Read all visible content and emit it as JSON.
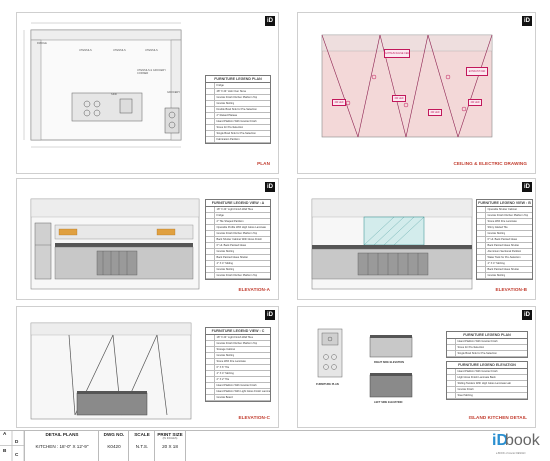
{
  "brand": {
    "logo_mark": "iD",
    "name": "book",
    "tagline": "a BOOK of interior DESIGN"
  },
  "sheets": {
    "plan": {
      "caption": "PLAN",
      "rooms": [
        "FRIDGE",
        "UTENSILS",
        "UTENSILS",
        "UTENSILS",
        "UTENSILS & GROCERY CORNER",
        "GROCERY",
        "SINK"
      ],
      "legend_title": "FURNITURE LEGEND PLAN",
      "legend": [
        "Fridge",
        "48\" X 24\" Hob Over Stove",
        "Granite Finish Kitchen Platform Top",
        "Granite Skirting",
        "Double Bowl Sink for Pre-Selection",
        "2\" Raised Plateau",
        "Island Platform With Granite Finish",
        "Stove for Pre-Selection",
        "Single Bowl Sink for Pre-Selection",
        "Fabrication Partition"
      ]
    },
    "ceiling": {
      "caption": "CEILING & ELECTRIC DRAWING",
      "tags": [
        "GYPSUM FALSE CEILING",
        "EXHAUST FAN",
        "4W LED",
        "4W LED",
        "4W LED",
        "4W LED"
      ]
    },
    "elev_a": {
      "caption": "ELEVATION-A",
      "legend_title": "FURNITURE LEGEND VIEW : A",
      "legend": [
        "18\" X 24\" Light Finish Wall Tiles",
        "Fridge",
        "2\" Tile Shaped Partition",
        "Operable Profile With High Gloss Laminate",
        "Granite Finish Kitchen Platform Top",
        "Back Shutter Cabinet With Gloss Finish",
        "6\" Ht. Back Painted Glass",
        "Granite Skirting",
        "Back Painted Glass Shelter",
        "4\" X 4\" Sliding",
        "Granite Skirting",
        "Granite Finish Kitchen Platform Top"
      ]
    },
    "elev_b": {
      "caption": "ELEVATION-B",
      "legend_title": "FURNITURE LEGEND VIEW : B",
      "legend": [
        "Operable Shutter Cabinet",
        "Granite Finish Kitchen Platform Top",
        "Stone With Fire Laminate",
        "Shiny Glazed Tile",
        "Granite Skirting",
        "6\" Ht. Back Painted Glass",
        "Back Painted Glass Shutter",
        "Aluminium Sectional Partition",
        "Water Tank for Pre-Selection",
        "4\" X 4\" Skirting",
        "Back Painted Glass Shutter",
        "Granite Skirting"
      ]
    },
    "elev_c": {
      "caption": "ELEVATION-C",
      "legend_title": "FURNITURE LEGEND VIEW : C",
      "legend": [
        "18\" X 24\" Light Finish Wall Tiles",
        "Granite Finish Kitchen Platform Top",
        "Storage Cabinet",
        "Granite Skirting",
        "Stone With Fire Laminate",
        "6\" X 6\" Tile",
        "4\" X 4\" Skirting",
        "2\" X 2\" Tile",
        "Island Platform With Granite Finish",
        "Island Platform With Light Gloss Finish Laminate",
        "Granite Board"
      ]
    },
    "island": {
      "caption": "ISLAND KITCHEN DETAIL",
      "plan_cap": "FURNITURE PLAN",
      "right_cap": "RIGHT SIDE ELEVATION",
      "left_cap": "LEFT SIDE ELEVATION",
      "legend_title": "FURNITURE LEGEND PLAN",
      "legend": [
        "Island Platform With Granite Finish",
        "Stove for Pre-Selection",
        "Single Bowl Sink for Pre-Selection"
      ],
      "legend2_title": "FURNITURE LEGEND ELEVATION",
      "legend2": [
        "Island Platform With Granite Finish",
        "High Gloss Finish Laminate Back",
        "Sliding Tandem With High Gloss Laminate Lab",
        "Granite Finish",
        "Steel Skirting"
      ]
    }
  },
  "title_block": {
    "rev_letters": [
      "A",
      "D",
      "B",
      "C"
    ],
    "detail_header": "DETAIL PLANS",
    "detail_value": "KITCHEN : 18'-0\" X 12'-9\"",
    "dwg_header": "DWG NO.",
    "dwg_value": "K0420",
    "scale_header": "SCALE",
    "scale_value": "N.T.S.",
    "print_header": "PRINT SIZE",
    "print_sub": "(IN INCHES)",
    "print_value": "20 X 18"
  },
  "colors": {
    "accent_red": "#c0392b",
    "magenta": "#c2185b",
    "ceiling_fill": "#f3d8d8"
  }
}
